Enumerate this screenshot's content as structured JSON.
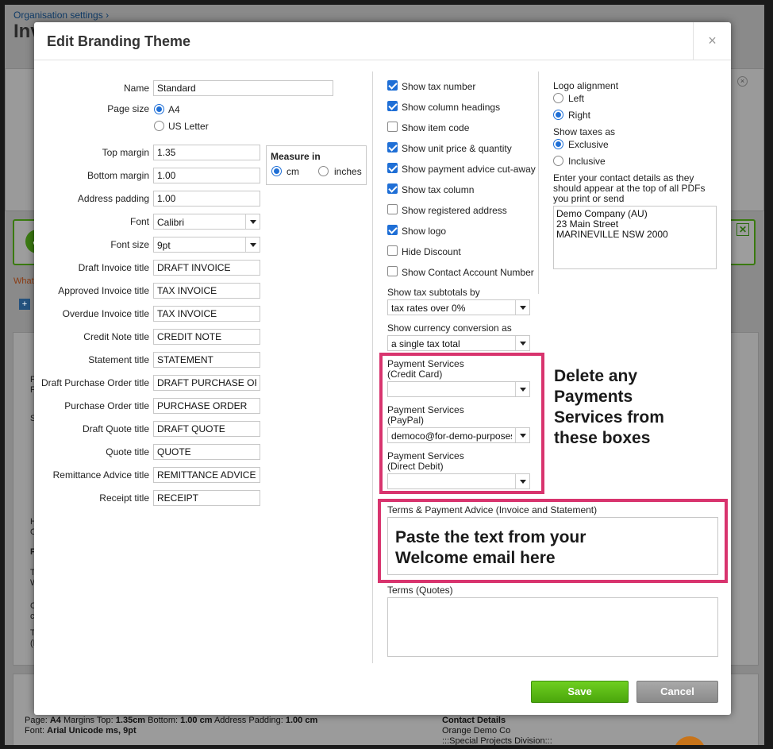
{
  "background": {
    "breadcrumb": "Organisation settings ›",
    "page_title": "Inv",
    "what_text": "What",
    "fragments": [
      "Pag",
      "For",
      "Sho",
      "Hea",
      "OR",
      "Pa",
      "Tern",
      "Whe",
      "On",
      "cre",
      "Ter",
      "(No"
    ],
    "bottom_card": {
      "line1_prefix": "Page:",
      "line1_page": "A4",
      "line1_mt_label": "Margins Top:",
      "line1_mt": "1.35cm",
      "line1_bottom_label": "Bottom:",
      "line1_bottom": "1.00 cm",
      "line1_ap_label": "Address Padding:",
      "line1_ap": "1.00 cm",
      "line2_label": "Font:",
      "line2_value": "Arial Unicode ms, 9pt",
      "contact_title": "Contact Details",
      "contact_line1": "Orange Demo Co",
      "contact_line2": ":::Special Projects Division:::"
    }
  },
  "modal": {
    "title": "Edit Branding Theme",
    "close_symbol": "×",
    "fields": {
      "name": {
        "label": "Name",
        "value": "Standard"
      },
      "page_size": {
        "label": "Page size",
        "options": [
          "A4",
          "US Letter"
        ],
        "selected": "A4"
      },
      "top_margin": {
        "label": "Top margin",
        "value": "1.35"
      },
      "bottom_margin": {
        "label": "Bottom margin",
        "value": "1.00"
      },
      "address_padding": {
        "label": "Address padding",
        "value": "1.00"
      },
      "font": {
        "label": "Font",
        "value": "Calibri"
      },
      "font_size": {
        "label": "Font size",
        "value": "9pt"
      },
      "draft_invoice_title": {
        "label": "Draft Invoice title",
        "value": "DRAFT INVOICE"
      },
      "approved_invoice_title": {
        "label": "Approved Invoice title",
        "value": "TAX INVOICE"
      },
      "overdue_invoice_title": {
        "label": "Overdue Invoice title",
        "value": "TAX INVOICE"
      },
      "credit_note_title": {
        "label": "Credit Note title",
        "value": "CREDIT NOTE"
      },
      "statement_title": {
        "label": "Statement title",
        "value": "STATEMENT"
      },
      "draft_po_title": {
        "label": "Draft Purchase Order title",
        "value": "DRAFT PURCHASE ORDER"
      },
      "po_title": {
        "label": "Purchase Order title",
        "value": "PURCHASE ORDER"
      },
      "draft_quote_title": {
        "label": "Draft Quote title",
        "value": "DRAFT QUOTE"
      },
      "quote_title": {
        "label": "Quote title",
        "value": "QUOTE"
      },
      "remittance_title": {
        "label": "Remittance Advice title",
        "value": "REMITTANCE ADVICE"
      },
      "receipt_title": {
        "label": "Receipt title",
        "value": "RECEIPT"
      }
    },
    "measure": {
      "title": "Measure in",
      "options": [
        "cm",
        "inches"
      ],
      "selected": "cm"
    },
    "checkboxes": [
      {
        "label": "Show tax number",
        "checked": true
      },
      {
        "label": "Show column headings",
        "checked": true
      },
      {
        "label": "Show item code",
        "checked": false
      },
      {
        "label": "Show unit price & quantity",
        "checked": true
      },
      {
        "label": "Show payment advice cut-away",
        "checked": true
      },
      {
        "label": "Show tax column",
        "checked": true
      },
      {
        "label": "Show registered address",
        "checked": false
      },
      {
        "label": "Show logo",
        "checked": true
      },
      {
        "label": "Hide Discount",
        "checked": false
      },
      {
        "label": "Show Contact Account Number",
        "checked": false
      }
    ],
    "tax_subtotals": {
      "label": "Show tax subtotals by",
      "value": "tax rates over 0%"
    },
    "currency_conversion": {
      "label": "Show currency conversion as",
      "value": "a single tax total"
    },
    "payment_services": {
      "credit_card": {
        "label_line1": "Payment Services",
        "label_line2": "(Credit Card)",
        "value": ""
      },
      "paypal": {
        "label_line1": "Payment Services",
        "label_line2": "(PayPal)",
        "value": "democo@for-demo-purposes-on"
      },
      "direct_debit": {
        "label_line1": "Payment Services",
        "label_line2": "(Direct Debit)",
        "value": ""
      }
    },
    "logo_alignment": {
      "label": "Logo alignment",
      "options": [
        "Left",
        "Right"
      ],
      "selected": "Right"
    },
    "show_taxes_as": {
      "label": "Show taxes as",
      "options": [
        "Exclusive",
        "Inclusive"
      ],
      "selected": "Exclusive"
    },
    "contact_details": {
      "label": "Enter your contact details as they should appear at the top of all PDFs you print or send",
      "lines": [
        "Demo Company (AU)",
        "23 Main Street",
        "MARINEVILLE NSW 2000"
      ]
    },
    "terms_invoice": {
      "label": "Terms & Payment Advice (Invoice and Statement)",
      "value": ""
    },
    "terms_quotes": {
      "label": "Terms (Quotes)",
      "value": ""
    },
    "buttons": {
      "save": "Save",
      "cancel": "Cancel"
    }
  },
  "annotations": {
    "payments_note": [
      "Delete any",
      "Payments",
      "Services from",
      "these boxes"
    ],
    "terms_note": [
      "Paste the text from your",
      "Welcome email here"
    ],
    "highlight_color": "#d8346e"
  }
}
